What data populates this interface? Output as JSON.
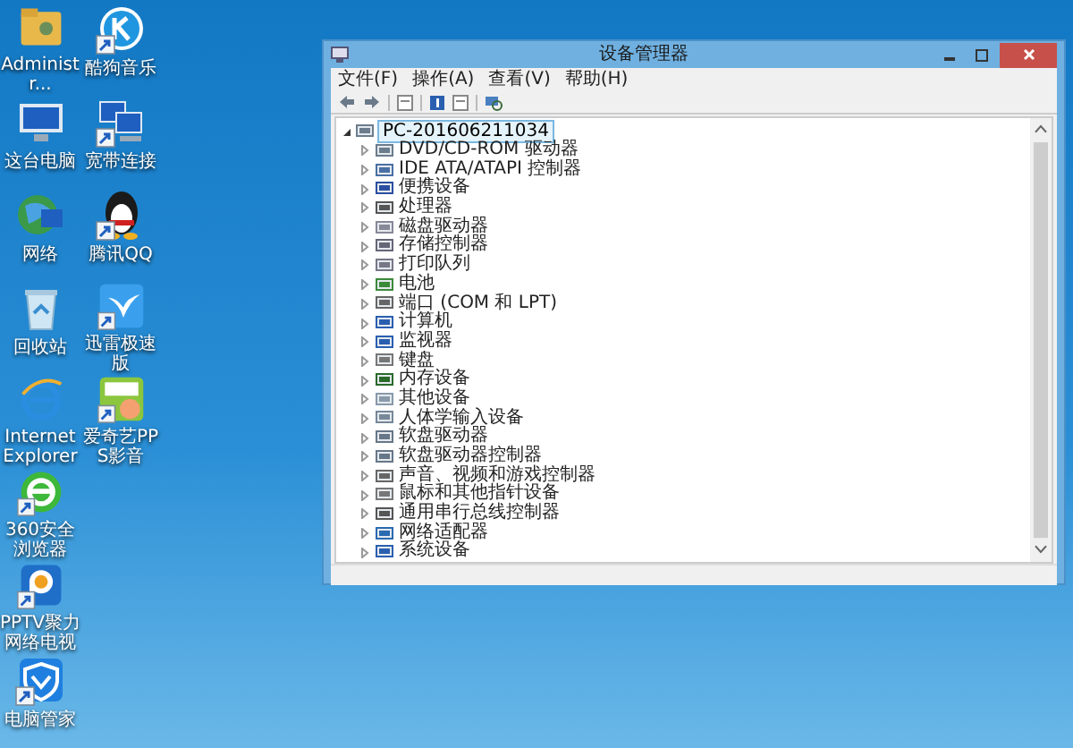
{
  "desktop_icons": [
    {
      "label": "Administr...",
      "shortcut": false
    },
    {
      "label": "这台电脑",
      "shortcut": false
    },
    {
      "label": "网络",
      "shortcut": false
    },
    {
      "label": "回收站",
      "shortcut": false
    },
    {
      "label": "Internet Explorer",
      "shortcut": false
    },
    {
      "label": "360安全浏览器",
      "shortcut": true
    },
    {
      "label": "PPTV聚力网络电视",
      "shortcut": true
    },
    {
      "label": "电脑管家",
      "shortcut": true
    },
    {
      "label": "酷狗音乐",
      "shortcut": true
    },
    {
      "label": "宽带连接",
      "shortcut": true
    },
    {
      "label": "腾讯QQ",
      "shortcut": true
    },
    {
      "label": "迅雷极速版",
      "shortcut": true
    },
    {
      "label": "爱奇艺PPS影音",
      "shortcut": true
    }
  ],
  "window": {
    "title": "设备管理器",
    "menu": [
      "文件(F)",
      "操作(A)",
      "查看(V)",
      "帮助(H)"
    ],
    "tree": {
      "label": "PC-201606211034",
      "expanded": true,
      "selected": true,
      "children": [
        {
          "label": "DVD/CD-ROM 驱动器",
          "expanded": false
        },
        {
          "label": "IDE ATA/ATAPI 控制器",
          "expanded": false
        },
        {
          "label": "便携设备",
          "expanded": false
        },
        {
          "label": "处理器",
          "expanded": false
        },
        {
          "label": "磁盘驱动器",
          "expanded": false
        },
        {
          "label": "存储控制器",
          "expanded": false
        },
        {
          "label": "打印队列",
          "expanded": false
        },
        {
          "label": "电池",
          "expanded": false
        },
        {
          "label": "端口 (COM 和 LPT)",
          "expanded": false
        },
        {
          "label": "计算机",
          "expanded": false
        },
        {
          "label": "监视器",
          "expanded": false
        },
        {
          "label": "键盘",
          "expanded": false
        },
        {
          "label": "内存设备",
          "expanded": false
        },
        {
          "label": "其他设备",
          "expanded": false
        },
        {
          "label": "人体学输入设备",
          "expanded": false
        },
        {
          "label": "软盘驱动器",
          "expanded": false
        },
        {
          "label": "软盘驱动器控制器",
          "expanded": false
        },
        {
          "label": "声音、视频和游戏控制器",
          "expanded": false
        },
        {
          "label": "鼠标和其他指针设备",
          "expanded": false
        },
        {
          "label": "通用串行总线控制器",
          "expanded": false
        },
        {
          "label": "网络适配器",
          "expanded": false
        },
        {
          "label": "系统设备",
          "expanded": false
        }
      ]
    }
  }
}
